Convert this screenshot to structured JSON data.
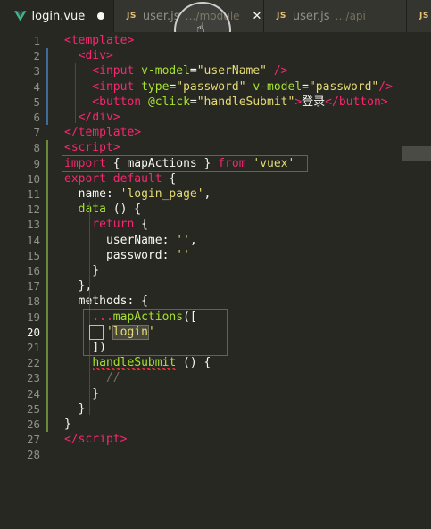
{
  "tabs": [
    {
      "label": "login.vue",
      "path": "",
      "icon": "vue-icon",
      "state": "modified",
      "active": true
    },
    {
      "label": "user.js",
      "path": "…/module",
      "icon": "js-icon",
      "state": "close",
      "active": false
    },
    {
      "label": "user.js",
      "path": "…/api",
      "icon": "js-icon",
      "state": "",
      "active": false
    },
    {
      "label": "",
      "path": "",
      "icon": "js-icon",
      "state": "",
      "active": false
    }
  ],
  "js_badge": "JS",
  "close_glyph": "✕",
  "cursor_glyph": "☝",
  "editor": {
    "current_line": 20,
    "lines": [
      {
        "n": "1",
        "mark": ""
      },
      {
        "n": "2",
        "mark": "blue"
      },
      {
        "n": "3",
        "mark": "blue"
      },
      {
        "n": "4",
        "mark": "blue"
      },
      {
        "n": "5",
        "mark": "blue"
      },
      {
        "n": "6",
        "mark": "blue"
      },
      {
        "n": "7",
        "mark": ""
      },
      {
        "n": "8",
        "mark": "green"
      },
      {
        "n": "9",
        "mark": "green"
      },
      {
        "n": "10",
        "mark": "green"
      },
      {
        "n": "11",
        "mark": "green"
      },
      {
        "n": "12",
        "mark": "green"
      },
      {
        "n": "13",
        "mark": "green"
      },
      {
        "n": "14",
        "mark": "green"
      },
      {
        "n": "15",
        "mark": "green"
      },
      {
        "n": "16",
        "mark": "green"
      },
      {
        "n": "17",
        "mark": "green"
      },
      {
        "n": "18",
        "mark": "green"
      },
      {
        "n": "19",
        "mark": "green"
      },
      {
        "n": "20",
        "mark": "green"
      },
      {
        "n": "21",
        "mark": "green"
      },
      {
        "n": "22",
        "mark": "green"
      },
      {
        "n": "23",
        "mark": "green"
      },
      {
        "n": "24",
        "mark": "green"
      },
      {
        "n": "25",
        "mark": "green"
      },
      {
        "n": "26",
        "mark": "green"
      },
      {
        "n": "27",
        "mark": ""
      },
      {
        "n": "28",
        "mark": ""
      }
    ],
    "code": {
      "l1": [
        "<",
        "template",
        ">"
      ],
      "l2": [
        "  <",
        "div",
        ">"
      ],
      "l3": [
        "    <",
        "input",
        " ",
        "v-model",
        "=",
        "\"userName\"",
        " />"
      ],
      "l4": [
        "    <",
        "input",
        " ",
        "type",
        "=",
        "\"password\"",
        " ",
        "v-model",
        "=",
        "\"password\"",
        "/>"
      ],
      "l5": [
        "    <",
        "button",
        " ",
        "@click",
        "=",
        "\"handleSubmit\"",
        ">",
        "登录",
        "</",
        "button",
        ">"
      ],
      "l6": [
        "  </",
        "div",
        ">"
      ],
      "l7": [
        "</",
        "template",
        ">"
      ],
      "l8": [
        "<",
        "script",
        ">"
      ],
      "l9": [
        "import",
        " { ",
        "mapActions",
        " } ",
        "from",
        " ",
        "'vuex'"
      ],
      "l10": [
        "export",
        " ",
        "default",
        " {"
      ],
      "l11": [
        "  ",
        "name",
        ": ",
        "'login_page'",
        ","
      ],
      "l12": [
        "  ",
        "data",
        " () {"
      ],
      "l13": [
        "    ",
        "return",
        " {"
      ],
      "l14": [
        "      ",
        "userName",
        ": ",
        "''",
        ","
      ],
      "l15": [
        "      ",
        "password",
        ": ",
        "''"
      ],
      "l16": [
        "    }"
      ],
      "l17": [
        "  },"
      ],
      "l18": [
        "  ",
        "methods",
        ": {"
      ],
      "l19": [
        "    ",
        "...",
        "mapActions",
        "(["
      ],
      "l20": [
        "      ",
        "'",
        "login",
        "'"
      ],
      "l21": [
        "    ",
        "])"
      ],
      "l22": [
        "    ",
        "handleSubmit",
        " () {"
      ],
      "l23": [
        "      ",
        "//"
      ],
      "l24": [
        "    }"
      ],
      "l25": [
        "  }"
      ],
      "l26": [
        "}"
      ],
      "l27": [
        "</",
        "script",
        ">"
      ],
      "l28": [
        ""
      ]
    }
  },
  "colors": {
    "background": "#272822",
    "tag": "#f92672",
    "attribute": "#a6e22e",
    "string": "#e6db74",
    "annotation_box": "#e02b2b"
  }
}
